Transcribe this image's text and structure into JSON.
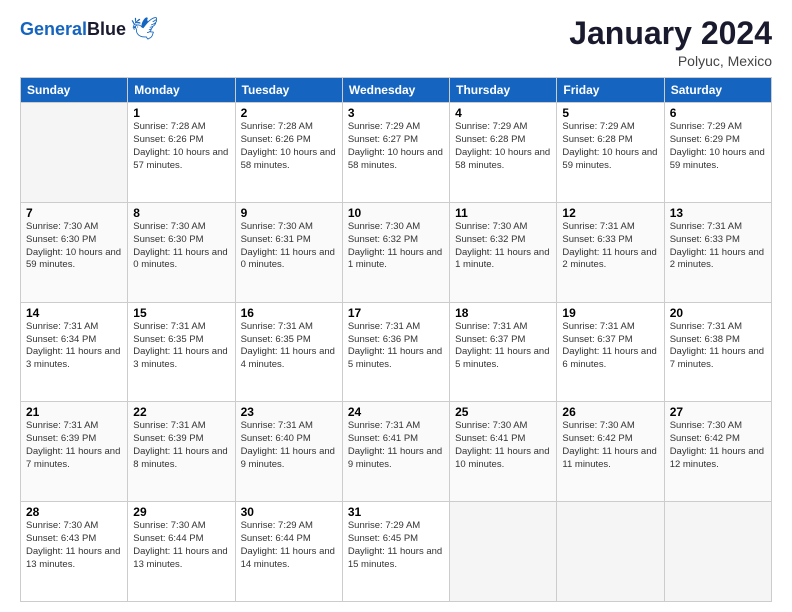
{
  "header": {
    "logo_line1": "General",
    "logo_line2": "Blue",
    "title": "January 2024",
    "subtitle": "Polyuc, Mexico"
  },
  "columns": [
    "Sunday",
    "Monday",
    "Tuesday",
    "Wednesday",
    "Thursday",
    "Friday",
    "Saturday"
  ],
  "weeks": [
    [
      {
        "day": "",
        "sunrise": "",
        "sunset": "",
        "daylight": ""
      },
      {
        "day": "1",
        "sunrise": "Sunrise: 7:28 AM",
        "sunset": "Sunset: 6:26 PM",
        "daylight": "Daylight: 10 hours and 57 minutes."
      },
      {
        "day": "2",
        "sunrise": "Sunrise: 7:28 AM",
        "sunset": "Sunset: 6:26 PM",
        "daylight": "Daylight: 10 hours and 58 minutes."
      },
      {
        "day": "3",
        "sunrise": "Sunrise: 7:29 AM",
        "sunset": "Sunset: 6:27 PM",
        "daylight": "Daylight: 10 hours and 58 minutes."
      },
      {
        "day": "4",
        "sunrise": "Sunrise: 7:29 AM",
        "sunset": "Sunset: 6:28 PM",
        "daylight": "Daylight: 10 hours and 58 minutes."
      },
      {
        "day": "5",
        "sunrise": "Sunrise: 7:29 AM",
        "sunset": "Sunset: 6:28 PM",
        "daylight": "Daylight: 10 hours and 59 minutes."
      },
      {
        "day": "6",
        "sunrise": "Sunrise: 7:29 AM",
        "sunset": "Sunset: 6:29 PM",
        "daylight": "Daylight: 10 hours and 59 minutes."
      }
    ],
    [
      {
        "day": "7",
        "sunrise": "Sunrise: 7:30 AM",
        "sunset": "Sunset: 6:30 PM",
        "daylight": "Daylight: 10 hours and 59 minutes."
      },
      {
        "day": "8",
        "sunrise": "Sunrise: 7:30 AM",
        "sunset": "Sunset: 6:30 PM",
        "daylight": "Daylight: 11 hours and 0 minutes."
      },
      {
        "day": "9",
        "sunrise": "Sunrise: 7:30 AM",
        "sunset": "Sunset: 6:31 PM",
        "daylight": "Daylight: 11 hours and 0 minutes."
      },
      {
        "day": "10",
        "sunrise": "Sunrise: 7:30 AM",
        "sunset": "Sunset: 6:32 PM",
        "daylight": "Daylight: 11 hours and 1 minute."
      },
      {
        "day": "11",
        "sunrise": "Sunrise: 7:30 AM",
        "sunset": "Sunset: 6:32 PM",
        "daylight": "Daylight: 11 hours and 1 minute."
      },
      {
        "day": "12",
        "sunrise": "Sunrise: 7:31 AM",
        "sunset": "Sunset: 6:33 PM",
        "daylight": "Daylight: 11 hours and 2 minutes."
      },
      {
        "day": "13",
        "sunrise": "Sunrise: 7:31 AM",
        "sunset": "Sunset: 6:33 PM",
        "daylight": "Daylight: 11 hours and 2 minutes."
      }
    ],
    [
      {
        "day": "14",
        "sunrise": "Sunrise: 7:31 AM",
        "sunset": "Sunset: 6:34 PM",
        "daylight": "Daylight: 11 hours and 3 minutes."
      },
      {
        "day": "15",
        "sunrise": "Sunrise: 7:31 AM",
        "sunset": "Sunset: 6:35 PM",
        "daylight": "Daylight: 11 hours and 3 minutes."
      },
      {
        "day": "16",
        "sunrise": "Sunrise: 7:31 AM",
        "sunset": "Sunset: 6:35 PM",
        "daylight": "Daylight: 11 hours and 4 minutes."
      },
      {
        "day": "17",
        "sunrise": "Sunrise: 7:31 AM",
        "sunset": "Sunset: 6:36 PM",
        "daylight": "Daylight: 11 hours and 5 minutes."
      },
      {
        "day": "18",
        "sunrise": "Sunrise: 7:31 AM",
        "sunset": "Sunset: 6:37 PM",
        "daylight": "Daylight: 11 hours and 5 minutes."
      },
      {
        "day": "19",
        "sunrise": "Sunrise: 7:31 AM",
        "sunset": "Sunset: 6:37 PM",
        "daylight": "Daylight: 11 hours and 6 minutes."
      },
      {
        "day": "20",
        "sunrise": "Sunrise: 7:31 AM",
        "sunset": "Sunset: 6:38 PM",
        "daylight": "Daylight: 11 hours and 7 minutes."
      }
    ],
    [
      {
        "day": "21",
        "sunrise": "Sunrise: 7:31 AM",
        "sunset": "Sunset: 6:39 PM",
        "daylight": "Daylight: 11 hours and 7 minutes."
      },
      {
        "day": "22",
        "sunrise": "Sunrise: 7:31 AM",
        "sunset": "Sunset: 6:39 PM",
        "daylight": "Daylight: 11 hours and 8 minutes."
      },
      {
        "day": "23",
        "sunrise": "Sunrise: 7:31 AM",
        "sunset": "Sunset: 6:40 PM",
        "daylight": "Daylight: 11 hours and 9 minutes."
      },
      {
        "day": "24",
        "sunrise": "Sunrise: 7:31 AM",
        "sunset": "Sunset: 6:41 PM",
        "daylight": "Daylight: 11 hours and 9 minutes."
      },
      {
        "day": "25",
        "sunrise": "Sunrise: 7:30 AM",
        "sunset": "Sunset: 6:41 PM",
        "daylight": "Daylight: 11 hours and 10 minutes."
      },
      {
        "day": "26",
        "sunrise": "Sunrise: 7:30 AM",
        "sunset": "Sunset: 6:42 PM",
        "daylight": "Daylight: 11 hours and 11 minutes."
      },
      {
        "day": "27",
        "sunrise": "Sunrise: 7:30 AM",
        "sunset": "Sunset: 6:42 PM",
        "daylight": "Daylight: 11 hours and 12 minutes."
      }
    ],
    [
      {
        "day": "28",
        "sunrise": "Sunrise: 7:30 AM",
        "sunset": "Sunset: 6:43 PM",
        "daylight": "Daylight: 11 hours and 13 minutes."
      },
      {
        "day": "29",
        "sunrise": "Sunrise: 7:30 AM",
        "sunset": "Sunset: 6:44 PM",
        "daylight": "Daylight: 11 hours and 13 minutes."
      },
      {
        "day": "30",
        "sunrise": "Sunrise: 7:29 AM",
        "sunset": "Sunset: 6:44 PM",
        "daylight": "Daylight: 11 hours and 14 minutes."
      },
      {
        "day": "31",
        "sunrise": "Sunrise: 7:29 AM",
        "sunset": "Sunset: 6:45 PM",
        "daylight": "Daylight: 11 hours and 15 minutes."
      },
      {
        "day": "",
        "sunrise": "",
        "sunset": "",
        "daylight": ""
      },
      {
        "day": "",
        "sunrise": "",
        "sunset": "",
        "daylight": ""
      },
      {
        "day": "",
        "sunrise": "",
        "sunset": "",
        "daylight": ""
      }
    ]
  ]
}
